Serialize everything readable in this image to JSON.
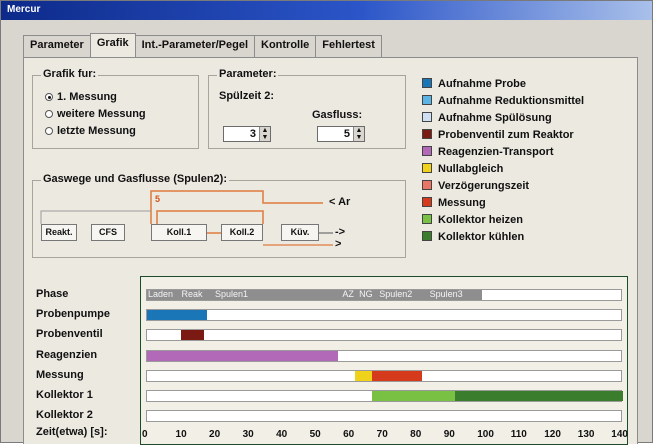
{
  "window": {
    "title": "Mercur"
  },
  "tabs": [
    {
      "label": "Parameter"
    },
    {
      "label": "Grafik"
    },
    {
      "label": "Int.-Parameter/Pegel"
    },
    {
      "label": "Kontrolle"
    },
    {
      "label": "Fehlertest"
    }
  ],
  "grafik_fuer": {
    "title": "Grafik fur:",
    "options": [
      {
        "label": "1. Messung",
        "selected": true
      },
      {
        "label": "weitere Messung",
        "selected": false
      },
      {
        "label": "letzte Messung",
        "selected": false
      }
    ]
  },
  "parameter": {
    "title": "Parameter:",
    "spuelzeit_label": "Spülzeit 2:",
    "gasfluss_label": "Gasfluss:",
    "spuelzeit_value": "3",
    "gasfluss_value": "5"
  },
  "gaswege": {
    "title": "Gaswege und Gasflusse (Spulen2):",
    "ar_label": "< Ar",
    "arrow1": "->",
    "arrow2": ">",
    "number_label": "5",
    "boxes": [
      "Reakt.",
      "CFS",
      "Koll.1",
      "Koll.2",
      "Küv."
    ]
  },
  "legend": [
    {
      "label": "Aufnahme Probe",
      "color": "#1b76b8"
    },
    {
      "label": "Aufnahme Reduktionsmittel",
      "color": "#5ab4e6"
    },
    {
      "label": "Aufnahme Spülösung",
      "color": "#cfe0f3"
    },
    {
      "label": "Probenventil zum Reaktor",
      "color": "#7a1a12"
    },
    {
      "label": "Reagenzien-Transport",
      "color": "#b26ab8"
    },
    {
      "label": "Nullabgleich",
      "color": "#f1d21a"
    },
    {
      "label": "Verzögerungszeit",
      "color": "#ea7766"
    },
    {
      "label": "Messung",
      "color": "#d63a1c"
    },
    {
      "label": "Kollektor heizen",
      "color": "#79c143"
    },
    {
      "label": "Kollektor kühlen",
      "color": "#3a7d2d"
    }
  ],
  "timeline": {
    "axis_label": "Zeit(etwa) [s]:",
    "ticks": [
      0,
      10,
      20,
      30,
      40,
      50,
      60,
      70,
      80,
      90,
      100,
      110,
      120,
      130,
      140
    ],
    "lanes": [
      {
        "label": "Phase",
        "segments": [
          {
            "start": 0,
            "end": 100,
            "color": "#8e8e8e"
          }
        ],
        "texts": [
          {
            "text": "Laden",
            "at": 0
          },
          {
            "text": "Reak",
            "at": 10
          },
          {
            "text": "Spulen1",
            "at": 20
          },
          {
            "text": "AZ",
            "at": 58
          },
          {
            "text": "NG",
            "at": 63
          },
          {
            "text": "Spulen2",
            "at": 69
          },
          {
            "text": "Spulen3",
            "at": 84
          }
        ]
      },
      {
        "label": "Probenpumpe",
        "segments": [
          {
            "start": 0,
            "end": 18,
            "color": "#1b76b8"
          }
        ]
      },
      {
        "label": "Probenventil",
        "segments": [
          {
            "start": 10,
            "end": 17,
            "color": "#7a1a12"
          }
        ]
      },
      {
        "label": "Reagenzien",
        "segments": [
          {
            "start": 0,
            "end": 57,
            "color": "#b26ab8"
          }
        ]
      },
      {
        "label": "Messung",
        "segments": [
          {
            "start": 62,
            "end": 67,
            "color": "#f1d21a"
          },
          {
            "start": 67,
            "end": 82,
            "color": "#d63a1c"
          }
        ]
      },
      {
        "label": "Kollektor 1",
        "segments": [
          {
            "start": 67,
            "end": 92,
            "color": "#79c143"
          },
          {
            "start": 92,
            "end": 142,
            "color": "#3a7d2d"
          }
        ]
      },
      {
        "label": "Kollektor 2",
        "segments": []
      }
    ]
  }
}
